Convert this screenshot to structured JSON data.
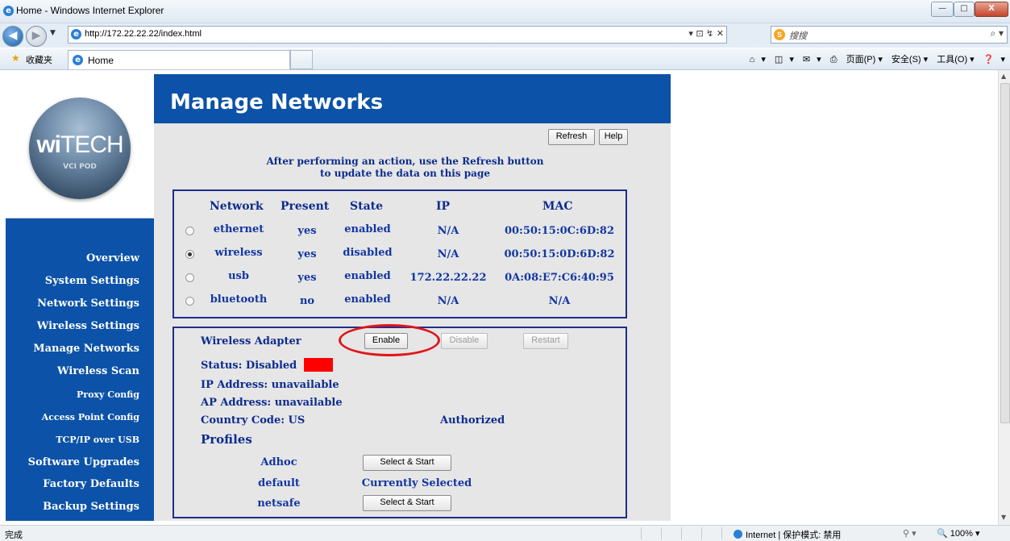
{
  "window": {
    "title": "Home - Windows Internet Explorer",
    "controls": {
      "minimize": "—",
      "maximize": "□",
      "close": "X"
    }
  },
  "address_bar": {
    "url": "http://172.22.22.22/index.html",
    "url_tools": "▾  ⊡  ↯  ✕",
    "search_placeholder": "搜搜",
    "search_go": "⌕ ▾"
  },
  "favorites_bar": {
    "favorites_label": "收藏夹",
    "tab_label": "Home",
    "commands": [
      "▾",
      "▾",
      "▾",
      "页面(P) ▾",
      "安全(S) ▾",
      "工具(O) ▾",
      "▾"
    ]
  },
  "logo": {
    "brand_bold": "wi",
    "brand_light": "TECH",
    "subtitle": "VCI POD"
  },
  "sidebar": {
    "items": [
      {
        "label": "Overview"
      },
      {
        "label": "System Settings"
      },
      {
        "label": "Network Settings"
      },
      {
        "label": "Wireless Settings"
      },
      {
        "label": "Manage Networks"
      },
      {
        "label": "Wireless Scan"
      },
      {
        "label": "Proxy Config"
      },
      {
        "label": "Access Point Config"
      },
      {
        "label": "TCP/IP over USB"
      },
      {
        "label": "Software Upgrades"
      },
      {
        "label": "Factory Defaults"
      },
      {
        "label": "Backup Settings"
      }
    ]
  },
  "page": {
    "title": "Manage Networks",
    "refresh_label": "Refresh",
    "help_label": "Help",
    "notice_line1": "After performing an action, use the Refresh button",
    "notice_line2": "to update the data on this page"
  },
  "networks": {
    "headers": [
      "Network",
      "Present",
      "State",
      "IP",
      "MAC"
    ],
    "rows": [
      {
        "network": "ethernet",
        "present": "yes",
        "state": "enabled",
        "ip": "N/A",
        "mac": "00:50:15:0C:6D:82",
        "selected": false
      },
      {
        "network": "wireless",
        "present": "yes",
        "state": "disabled",
        "ip": "N/A",
        "mac": "00:50:15:0D:6D:82",
        "selected": true
      },
      {
        "network": "usb",
        "present": "yes",
        "state": "enabled",
        "ip": "172.22.22.22",
        "mac": "0A:08:E7:C6:40:95",
        "selected": false
      },
      {
        "network": "bluetooth",
        "present": "no",
        "state": "enabled",
        "ip": "N/A",
        "mac": "N/A",
        "selected": false
      }
    ]
  },
  "adapter": {
    "title": "Wireless Adapter",
    "enable_label": "Enable",
    "disable_label": "Disable",
    "restart_label": "Restart",
    "status": "Status: Disabled",
    "status_color": "#ff0000",
    "ip_address": "IP Address: unavailable",
    "ap_address": "AP Address: unavailable",
    "country_code": "Country Code: US",
    "authorized": "Authorized",
    "profiles_label": "Profiles",
    "profiles": [
      {
        "name": "Adhoc",
        "action": "Select & Start"
      },
      {
        "name": "default",
        "action": "Currently Selected"
      },
      {
        "name": "netsafe",
        "action": "Select & Start"
      }
    ]
  },
  "status_bar": {
    "left": "完成",
    "zone": "Internet | 保护模式: 禁用",
    "lock": "⚲ ▾",
    "zoom": "🔍 100%  ▾"
  },
  "colors": {
    "brand_blue": "#0b52a8",
    "text_blue": "#1136a3",
    "highlight_red": "#e0151a"
  }
}
